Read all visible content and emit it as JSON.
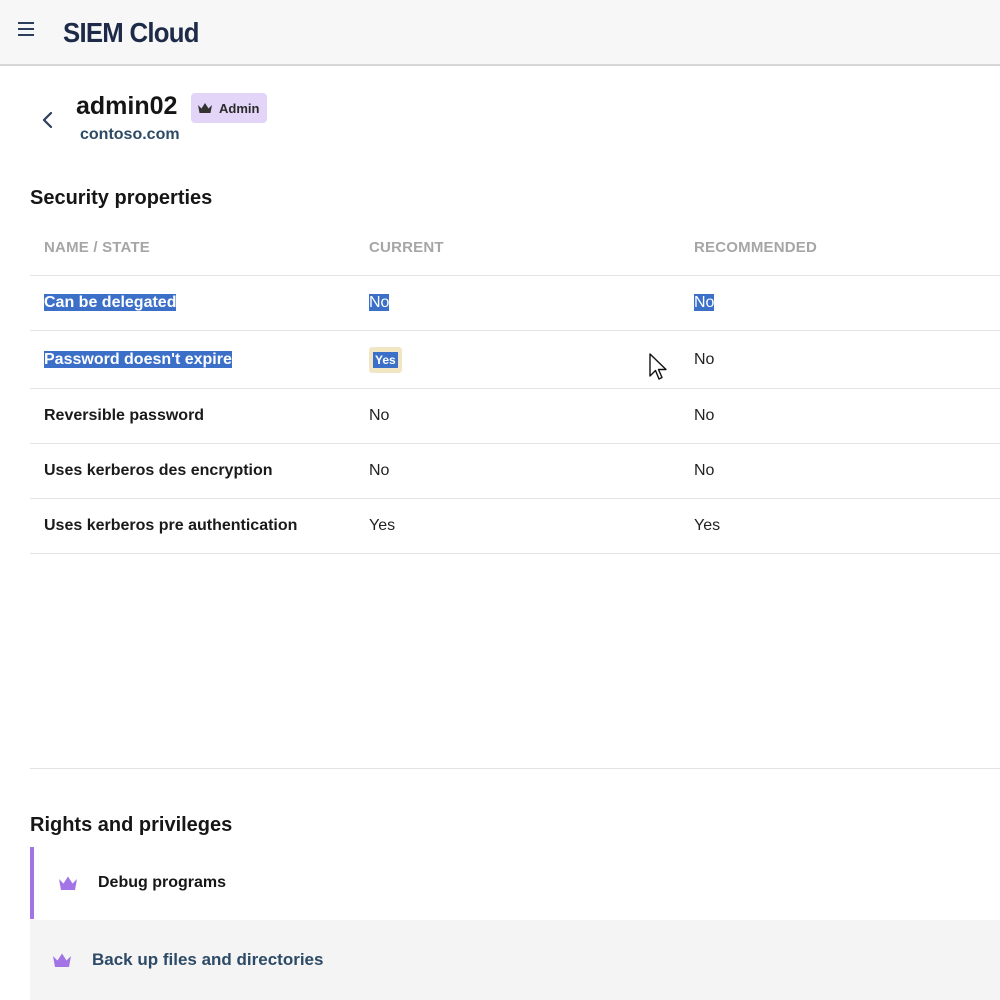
{
  "header": {
    "title": "SIEM Cloud"
  },
  "user": {
    "name": "admin02",
    "domain": "contoso.com",
    "role": "Admin"
  },
  "security": {
    "title": "Security properties",
    "columns": [
      "NAME / STATE",
      "CURRENT",
      "RECOMMENDED"
    ],
    "rows": [
      {
        "name": "Can be delegated",
        "current": "No",
        "recommended": "No"
      },
      {
        "name": "Password doesn't expire",
        "current": "Yes",
        "recommended": "No"
      },
      {
        "name": "Reversible password",
        "current": "No",
        "recommended": "No"
      },
      {
        "name": "Uses kerberos des encryption",
        "current": "No",
        "recommended": "No"
      },
      {
        "name": "Uses kerberos pre authentication",
        "current": "Yes",
        "recommended": "Yes"
      }
    ]
  },
  "rights": {
    "title": "Rights and privileges",
    "items": [
      {
        "label": "Debug programs",
        "icon": "crown-icon"
      },
      {
        "label": "Back up files and directories",
        "icon": "crown-icon"
      }
    ]
  },
  "colors": {
    "accent": "#a274e6",
    "selection": "#3b6fc8",
    "badge": "#e3d5f7"
  }
}
